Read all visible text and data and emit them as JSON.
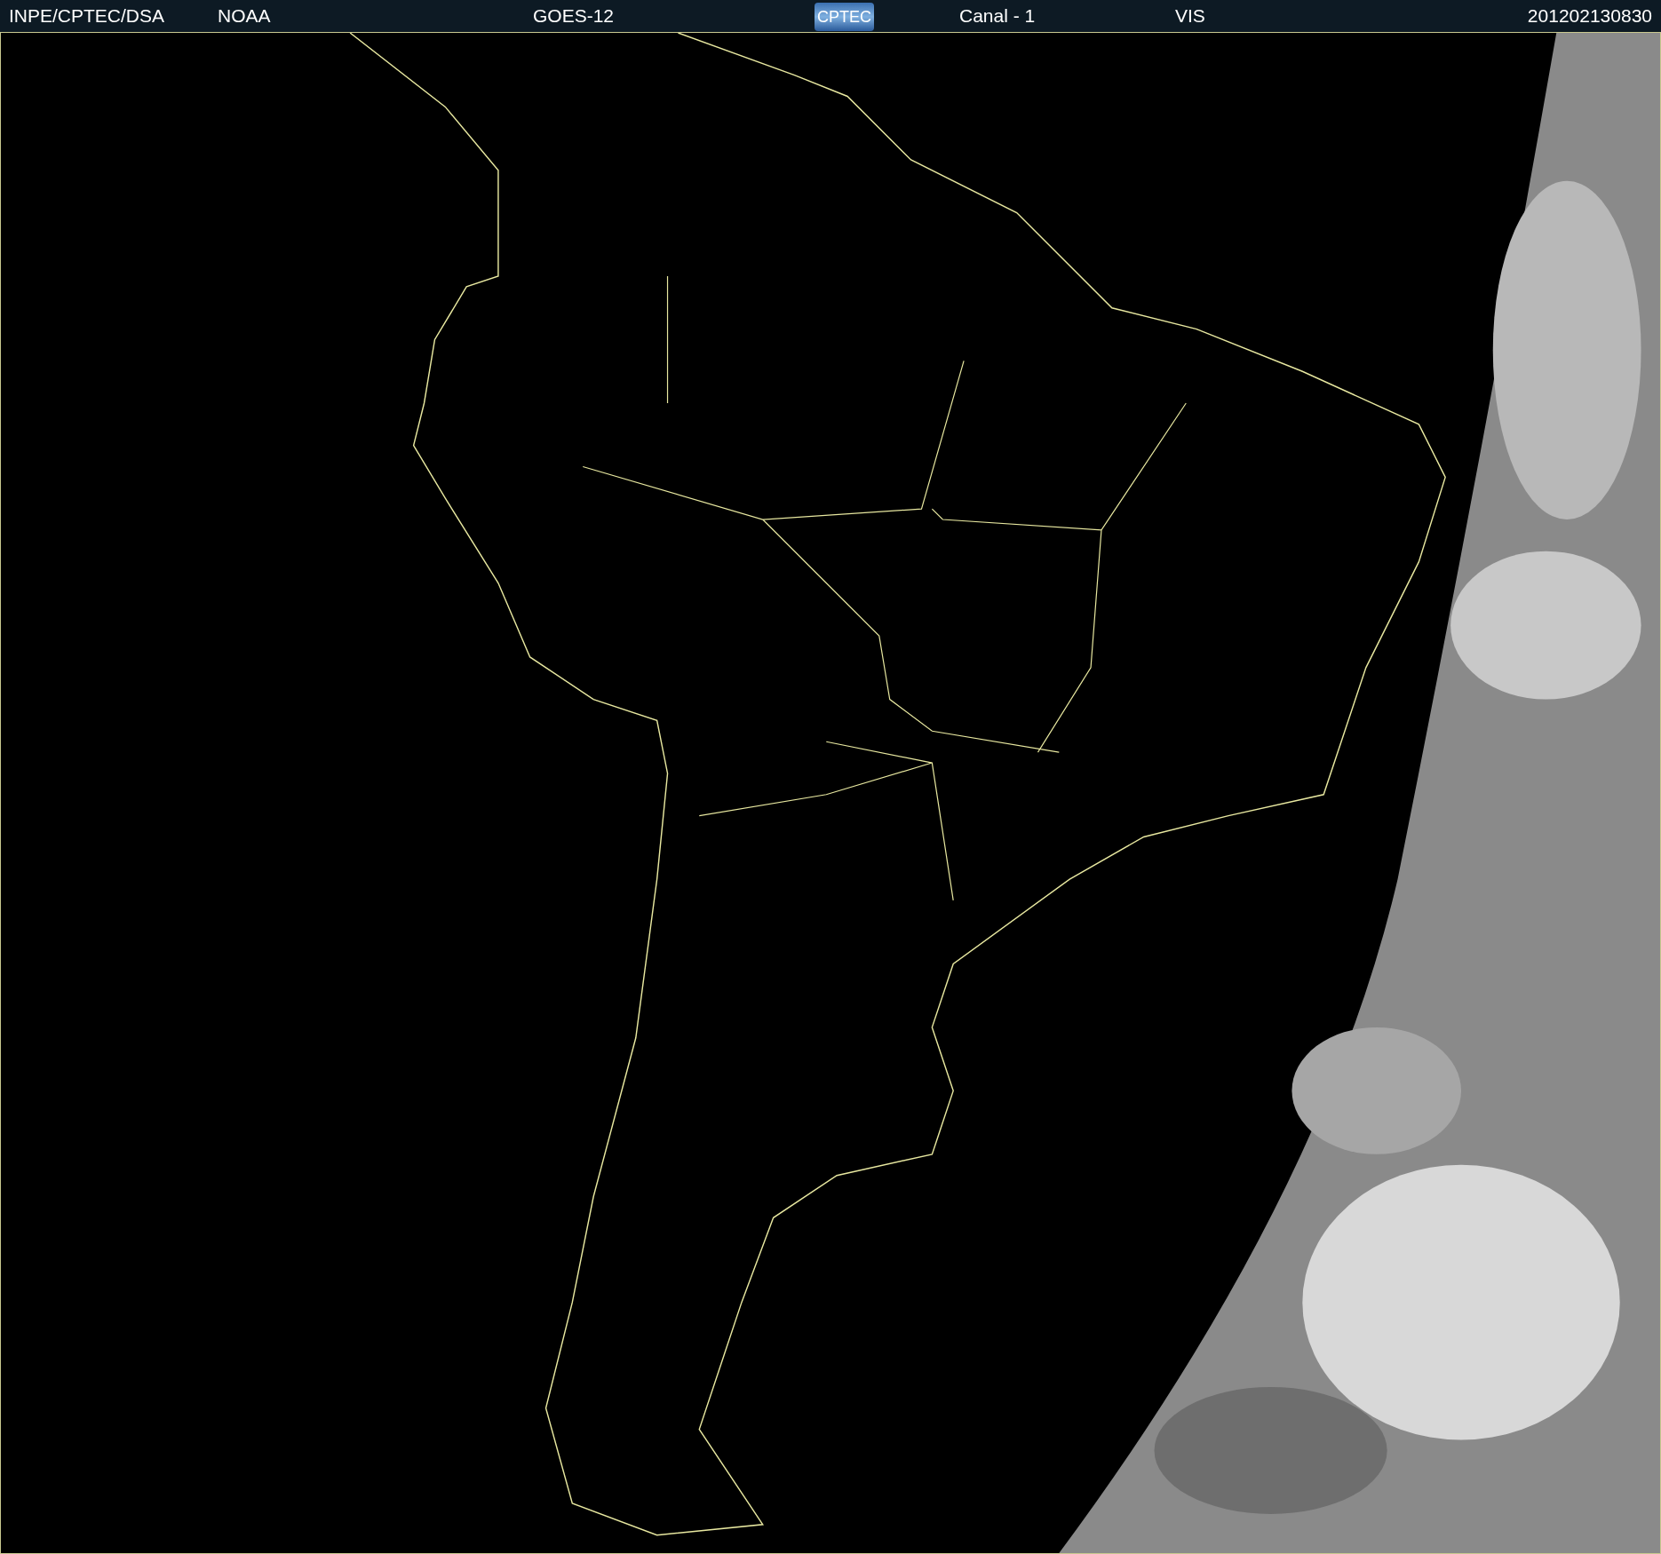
{
  "header": {
    "items": [
      {
        "kind": "text",
        "text": "INPE/CPTEC/DSA"
      },
      {
        "kind": "text",
        "text": "NOAA"
      },
      {
        "kind": "text",
        "text": "GOES-12"
      },
      {
        "kind": "logo",
        "text": "CPTEC"
      },
      {
        "kind": "text",
        "text": "Canal - 1"
      },
      {
        "kind": "text",
        "text": "VIS"
      },
      {
        "kind": "text",
        "text": "201202130830"
      }
    ]
  }
}
